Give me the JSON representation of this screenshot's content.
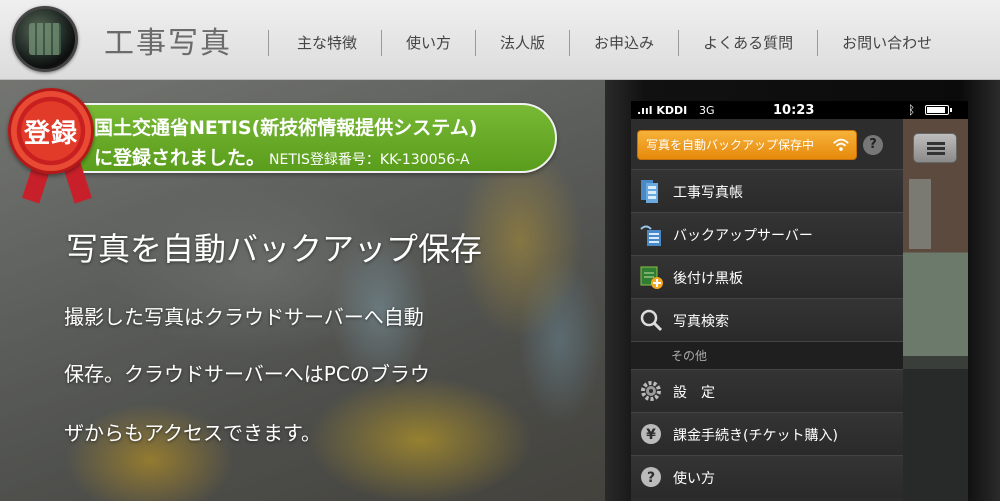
{
  "header": {
    "site_title": "工事写真",
    "nav": [
      "主な特徴",
      "使い方",
      "法人版",
      "お申込み",
      "よくある質問",
      "お問い合わせ"
    ]
  },
  "hero": {
    "badge_text": "登録",
    "banner_line1": "国土交通省NETIS(新技術情報提供システム)",
    "banner_line2": "に登録されました。",
    "banner_reg": "NETIS登録番号：KK-130056-A",
    "title": "写真を自動バックアップ保存",
    "body_lines": [
      "撮影した写真はクラウドサーバーへ自動",
      "保存。クラウドサーバーへはPCのブラウ",
      "ザからもアクセスできます。"
    ]
  },
  "phone": {
    "carrier": "KDDI",
    "network": "3G",
    "time": "10:23",
    "backup_button": "写真を自動バックアップ保存中",
    "help_label": "?",
    "menu_items": [
      {
        "label": "工事写真帳",
        "icon": "album-icon"
      },
      {
        "label": "バックアップサーバー",
        "icon": "server-icon"
      },
      {
        "label": "後付け黒板",
        "icon": "blackboard-icon"
      },
      {
        "label": "写真検索",
        "icon": "search-icon"
      }
    ],
    "section_label": "その他",
    "other_items": [
      {
        "label": "設　定",
        "icon": "gear-icon"
      },
      {
        "label": "課金手続き(チケット購入)",
        "icon": "yen-icon"
      },
      {
        "label": "使い方",
        "icon": "help-icon"
      }
    ]
  },
  "colors": {
    "banner_green": "#6aab28",
    "badge_red": "#d9302a",
    "backup_orange": "#ef9e20"
  }
}
